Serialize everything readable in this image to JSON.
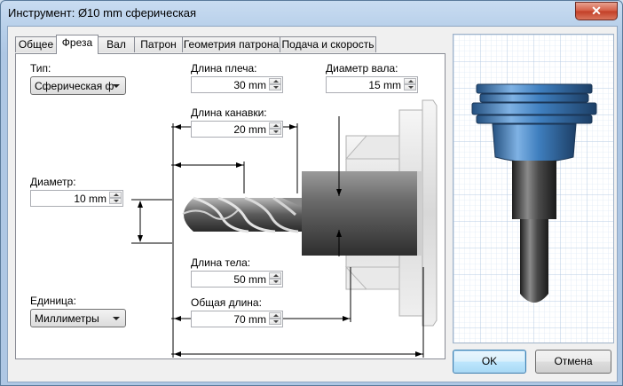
{
  "window": {
    "title": "Инструмент: Ø10 mm сферическая",
    "close_glyph": "✕"
  },
  "tabs": [
    {
      "label": "Общее",
      "active": false
    },
    {
      "label": "Фреза",
      "active": true
    },
    {
      "label": "Вал",
      "active": false
    },
    {
      "label": "Патрон",
      "active": false
    },
    {
      "label": "Геометрия патрона",
      "active": false
    },
    {
      "label": "Подача и скорость",
      "active": false
    }
  ],
  "form": {
    "type_label": "Тип:",
    "type_value": "Сферическая фр",
    "diameter_label": "Диаметр:",
    "diameter_value": "10 mm",
    "unit_label": "Единица:",
    "unit_value": "Миллиметры",
    "shoulder_label": "Длина плеча:",
    "shoulder_value": "30 mm",
    "groove_label": "Длина канавки:",
    "groove_value": "20 mm",
    "shaft_label": "Диаметр вала:",
    "shaft_value": "15 mm",
    "body_label": "Длина тела:",
    "body_value": "50 mm",
    "overall_label": "Общая длина:",
    "overall_value": "70 mm"
  },
  "buttons": {
    "ok": "OK",
    "cancel": "Отмена"
  },
  "colors": {
    "holder_blue": "#3f7fbf",
    "grid": "#c8d8ea",
    "tool_dark": "#4a4a4a"
  }
}
